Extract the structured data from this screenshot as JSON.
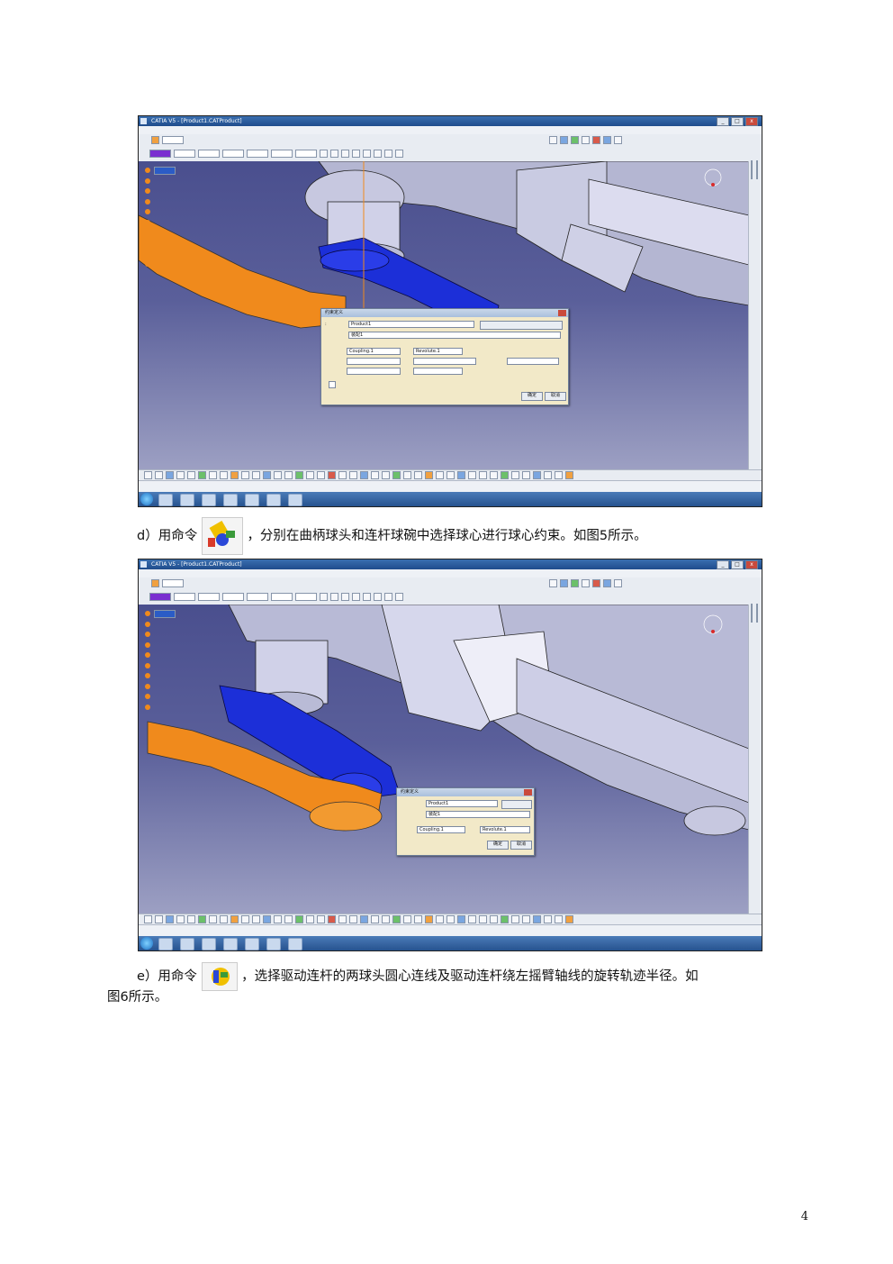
{
  "screenshots": [
    {
      "id": "figure-1",
      "window_title": "CATIA V5 - [Product1.CATProduct]",
      "dialog_title": "约束定义",
      "dialog_fields": [
        "Product1",
        "装配1",
        "Coupling.1",
        "Revolute.1"
      ],
      "dialog_buttons": [
        "确定",
        "取消"
      ]
    },
    {
      "id": "figure-2",
      "window_title": "CATIA V5 - [Product1.CATProduct]",
      "dialog_title": "约束定义",
      "dialog_fields": [
        "Product1",
        "装配1",
        "Coupling.1",
        "Revolute.1"
      ],
      "dialog_buttons": [
        "确定",
        "取消"
      ]
    }
  ],
  "paragraphs": {
    "d_prefix": "d）用命令",
    "d_suffix": "，分别在曲柄球头和连杆球碗中选择球心进行球心约束。如图5所示。",
    "e_prefix": "e）用命令",
    "e_suffix": "，选择驱动连杆的两球头圆心连线及驱动连杆绕左摇臂轴线的旋转轨迹半径。如",
    "e_line2": "图6所示。"
  },
  "page_number": "4",
  "colors": {
    "orange_part": "#f08a1c",
    "blue_part": "#1c2fd8",
    "viewport_top": "#4a4f8e"
  }
}
